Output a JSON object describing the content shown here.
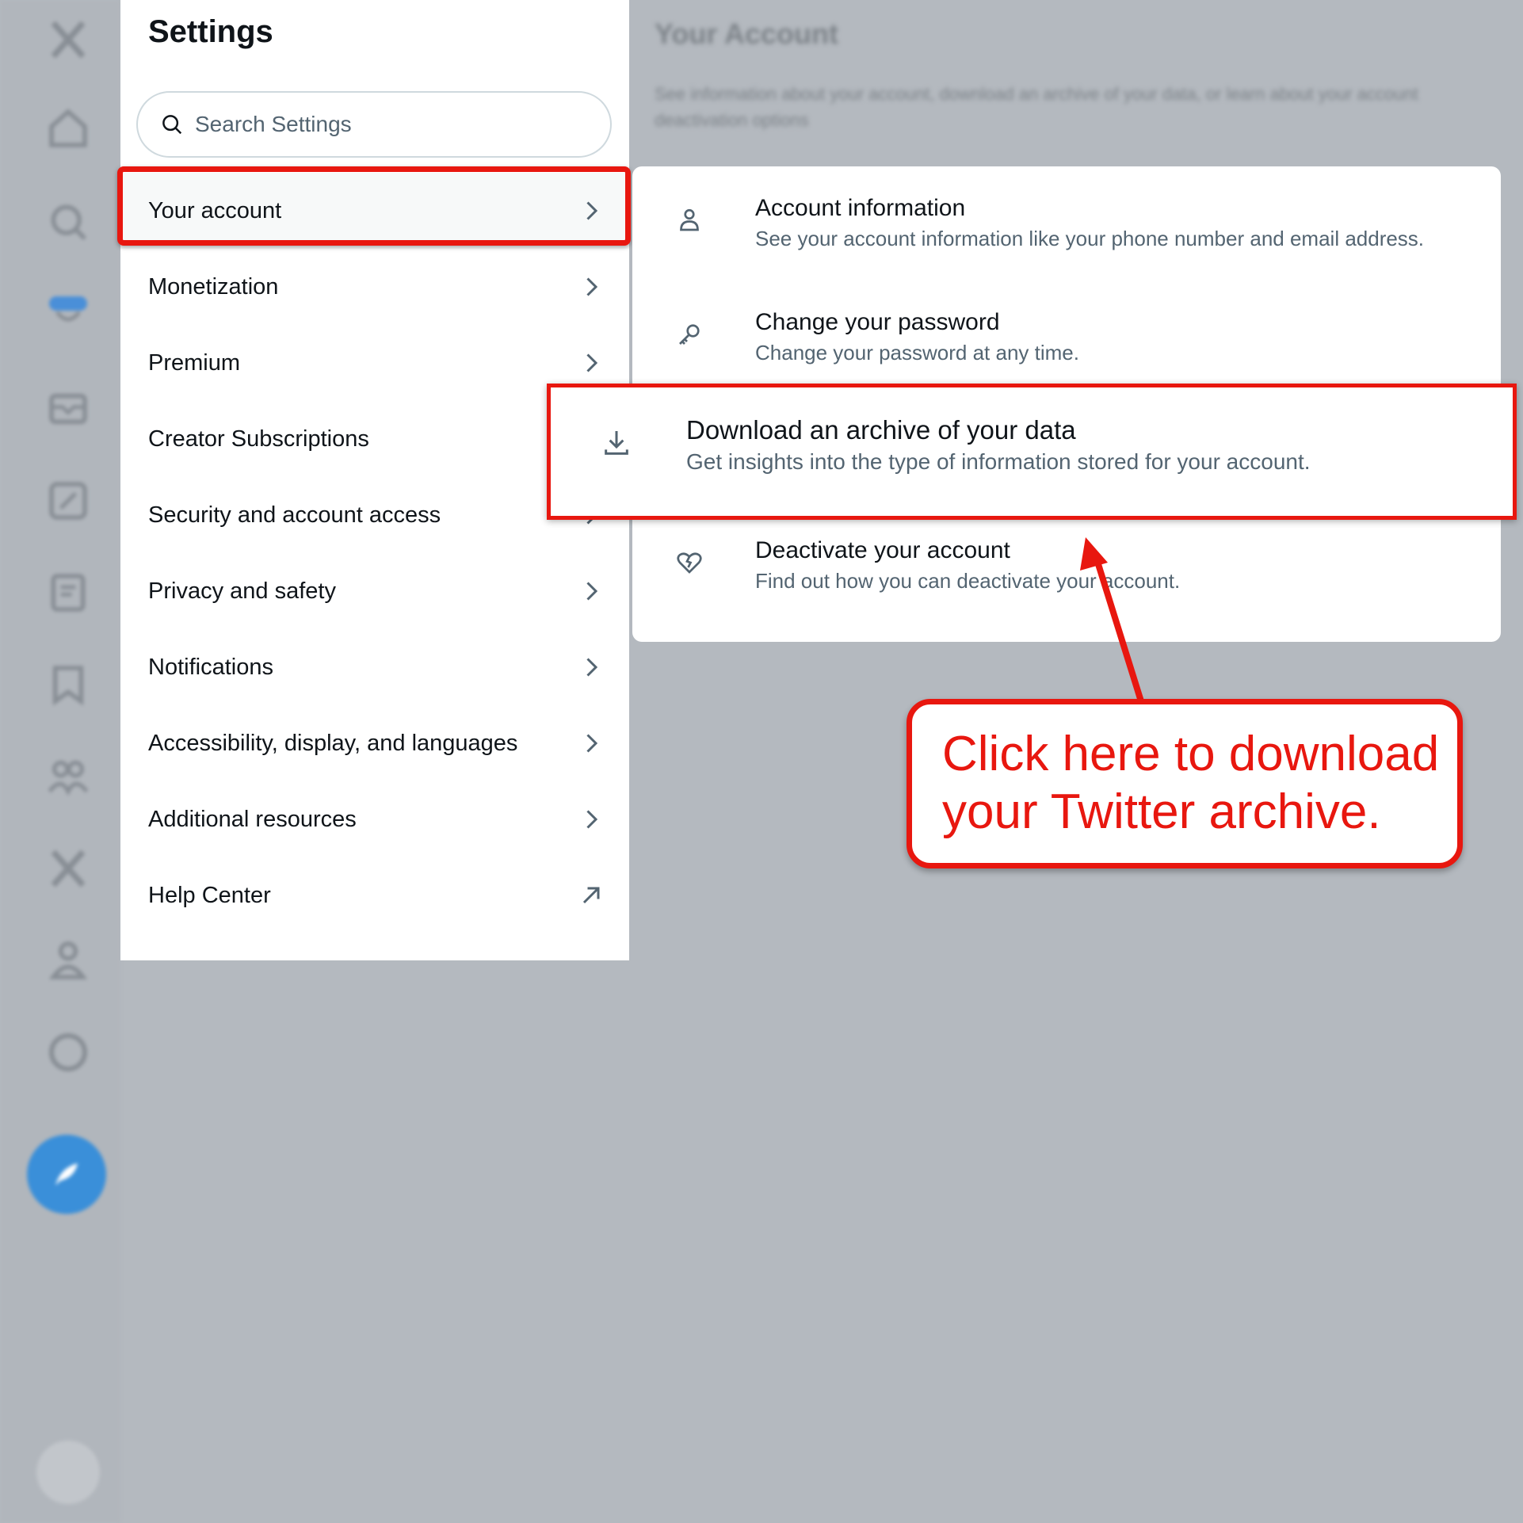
{
  "settings": {
    "title": "Settings",
    "search_placeholder": "Search Settings",
    "menu": [
      {
        "label": "Your account",
        "indicator": "chevron-right-icon",
        "selected": true
      },
      {
        "label": "Monetization",
        "indicator": "chevron-right-icon"
      },
      {
        "label": "Premium",
        "indicator": "chevron-right-icon"
      },
      {
        "label": "Creator Subscriptions",
        "indicator": "chevron-right-icon"
      },
      {
        "label": "Security and account access",
        "indicator": "chevron-right-icon"
      },
      {
        "label": "Privacy and safety",
        "indicator": "chevron-right-icon"
      },
      {
        "label": "Notifications",
        "indicator": "chevron-right-icon"
      },
      {
        "label": "Accessibility, display, and languages",
        "indicator": "chevron-right-icon"
      },
      {
        "label": "Additional resources",
        "indicator": "chevron-right-icon"
      },
      {
        "label": "Help Center",
        "indicator": "external-link-icon"
      }
    ]
  },
  "account": {
    "title": "Your Account",
    "description": "See information about your account, download an archive of your data, or learn about your account deactivation options",
    "items": [
      {
        "icon": "person-icon",
        "title": "Account information",
        "description": "See your account information like your phone number and email address."
      },
      {
        "icon": "key-icon",
        "title": "Change your password",
        "description": "Change your password at any time."
      },
      {
        "icon": "download-icon",
        "title": "Download an archive of your data",
        "description": "Get insights into the type of information stored for your account."
      },
      {
        "icon": "broken-heart-icon",
        "title": "Deactivate your account",
        "description": "Find out how you can deactivate your account."
      }
    ]
  },
  "callout": {
    "line1": "Click here to download",
    "line2": "your Twitter archive."
  },
  "colors": {
    "highlight": "#e8170f",
    "text_primary": "#0f1419",
    "text_secondary": "#536471",
    "overlay": "#b4b9bf"
  }
}
